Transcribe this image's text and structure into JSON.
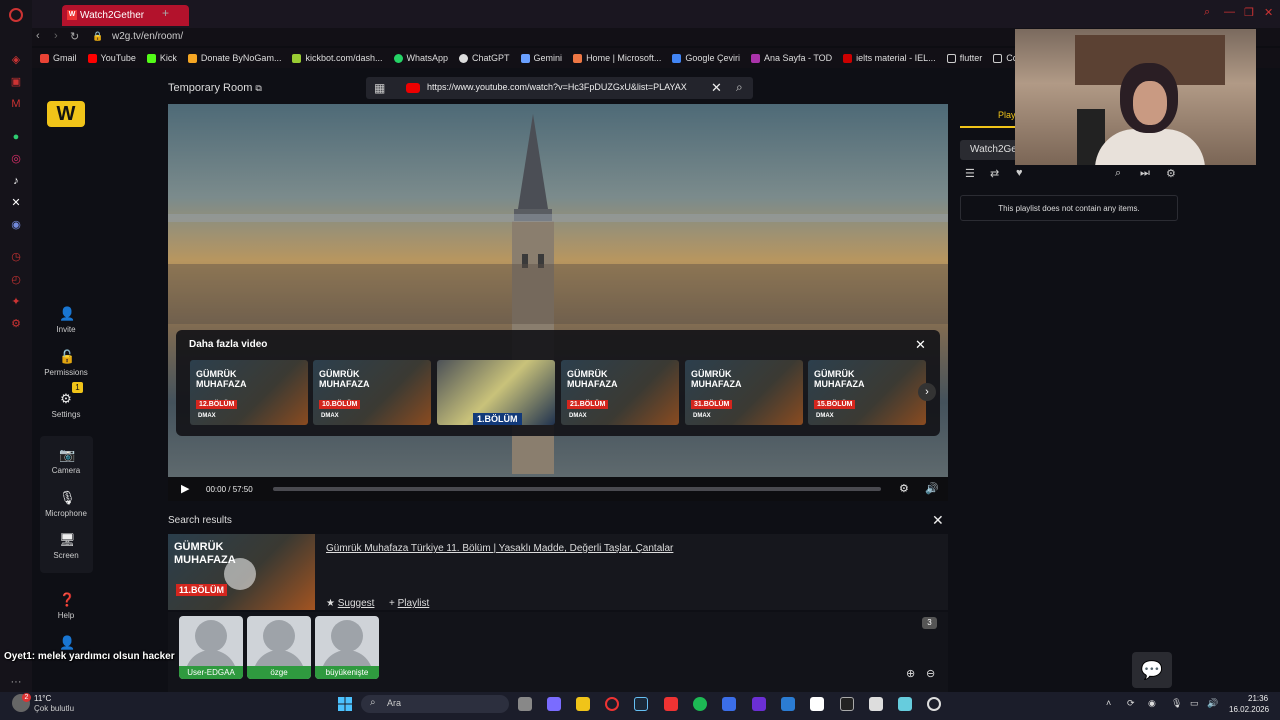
{
  "browser": {
    "tab_title": "Watch2Gether",
    "url": "w2g.tv/en/room/",
    "bookmarks": [
      "Gmail",
      "YouTube",
      "Kick",
      "Donate ByNoGam...",
      "kickbot.com/dash...",
      "WhatsApp",
      "ChatGPT",
      "Gemini",
      "Home | Microsoft...",
      "Google Çeviri",
      "Ana Sayfa - TOD",
      "ielts material - IEL...",
      "flutter",
      "Codi"
    ]
  },
  "sidebar": {
    "invite": "Invite",
    "permissions": "Permissions",
    "settings": "Settings",
    "settings_badge": "1",
    "camera": "Camera",
    "microphone": "Microphone",
    "screen": "Screen",
    "help": "Help"
  },
  "room": {
    "title": "Temporary Room",
    "video_url": "https://www.youtube.com/watch?v=Hc3FpDUZGxU&list=PLAYAX"
  },
  "more_videos": {
    "title": "Daha fazla video",
    "items": [
      {
        "line1": "GÜMRÜK",
        "line2": "MUHAFAZA",
        "ep": "12.BÖLÜM",
        "brand": "DMAX"
      },
      {
        "line1": "GÜMRÜK",
        "line2": "MUHAFAZA",
        "ep": "10.BÖLÜM",
        "brand": "DMAX"
      },
      {
        "label": "1.BÖLÜM"
      },
      {
        "line1": "GÜMRÜK",
        "line2": "MUHAFAZA",
        "ep": "21.BÖLÜM",
        "brand": "DMAX"
      },
      {
        "line1": "GÜMRÜK",
        "line2": "MUHAFAZA",
        "ep": "31.BÖLÜM",
        "brand": "DMAX"
      },
      {
        "line1": "GÜMRÜK",
        "line2": "MUHAFAZA",
        "ep": "15.BÖLÜM",
        "brand": "DMAX"
      }
    ]
  },
  "player": {
    "time": "00:00 / 57:50",
    "progress": 0
  },
  "search_results": {
    "title": "Search results",
    "result": {
      "title": "Gümrük Muhafaza Türkiye 11. Bölüm | Yasaklı Madde, Değerli Taşlar, Çantalar",
      "thumb_line1": "GÜMRÜK",
      "thumb_line2": "MUHAFAZA",
      "thumb_ep": "11.BÖLÜM",
      "suggest": "Suggest",
      "playlist": "Playlist"
    }
  },
  "users": {
    "count": "3",
    "names": [
      "User-EDGAA",
      "özge",
      "büyükenişte"
    ]
  },
  "overlay_text": "Oyet1: melek yardımcı olsun hacker",
  "right_panel": {
    "tab": "Playl",
    "playlist_name": "Watch2Ge",
    "empty_message": "This playlist does not contain any items."
  },
  "taskbar": {
    "temp": "11°C",
    "weather": "Çok bulutlu",
    "search_placeholder": "Ara",
    "time": "21:36",
    "date": "16.02.2026",
    "weather_badge": "2"
  },
  "colors": {
    "accent": "#f0c419",
    "tab_red": "#b3122c",
    "user_green": "#2f9a3f",
    "youtube_red": "#e00000"
  }
}
